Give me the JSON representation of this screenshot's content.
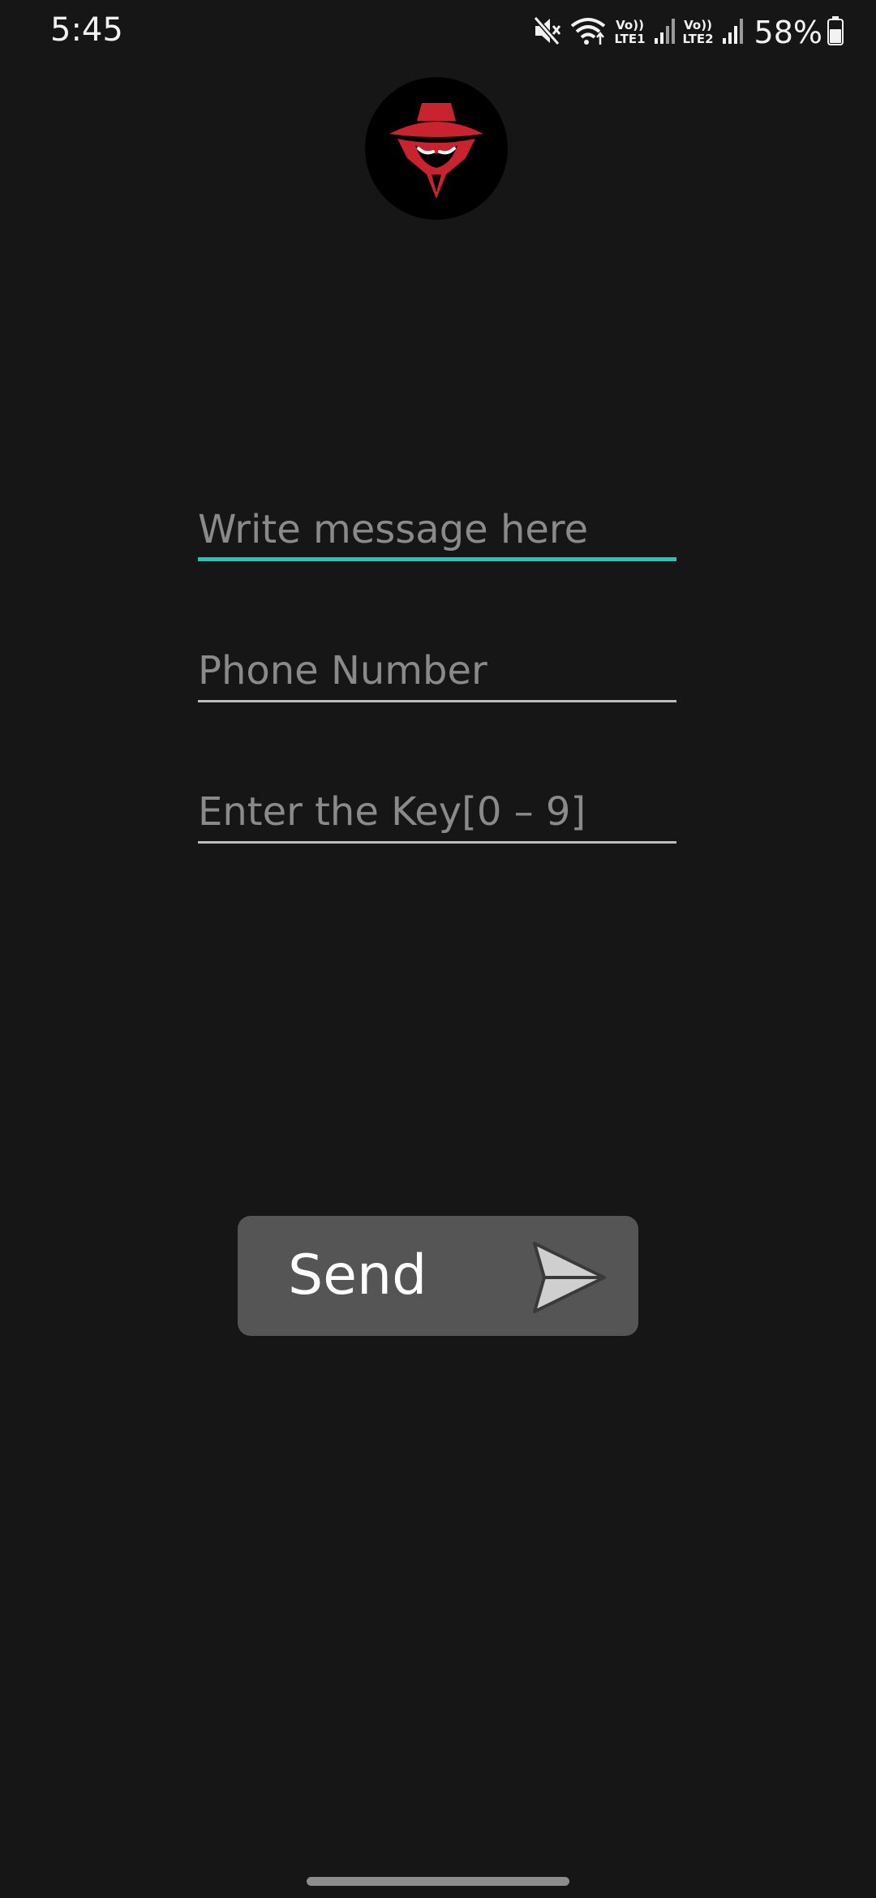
{
  "status_bar": {
    "time": "5:45",
    "sim1_label_top": "Vo))",
    "sim1_label_bottom": "LTE1",
    "sim2_label_top": "Vo))",
    "sim2_label_bottom": "LTE2",
    "battery": "58%",
    "icons": [
      "mute-icon",
      "wifi-icon",
      "signal-icon",
      "signal-icon",
      "battery-icon"
    ]
  },
  "app": {
    "logo_icon": "spy-hat-logo-icon"
  },
  "form": {
    "message_placeholder": "Write message here",
    "phone_placeholder": "Phone Number",
    "key_placeholder": "Enter the Key[0 – 9]",
    "message_value": "",
    "phone_value": "",
    "key_value": ""
  },
  "send_button": {
    "label": "Send",
    "icon": "paper-plane-icon"
  },
  "colors": {
    "background": "#161616",
    "accent": "#21c7b8",
    "button": "#555555",
    "logo_red": "#c8232e"
  }
}
